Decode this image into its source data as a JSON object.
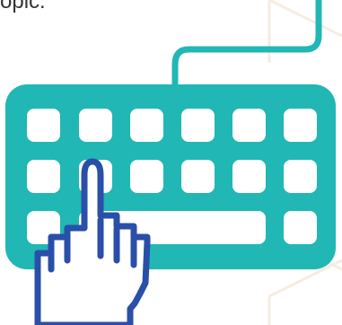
{
  "caption": {
    "text": "opic."
  },
  "colors": {
    "keyboard": "#20b7b5",
    "keys": "#ffffff",
    "hand_outline": "#2a4fa8",
    "hand_fill": "#ffffff",
    "background_pattern": "#f6ece0"
  },
  "icons": [
    "keyboard-icon",
    "hand-pointer-icon",
    "cable-icon"
  ]
}
